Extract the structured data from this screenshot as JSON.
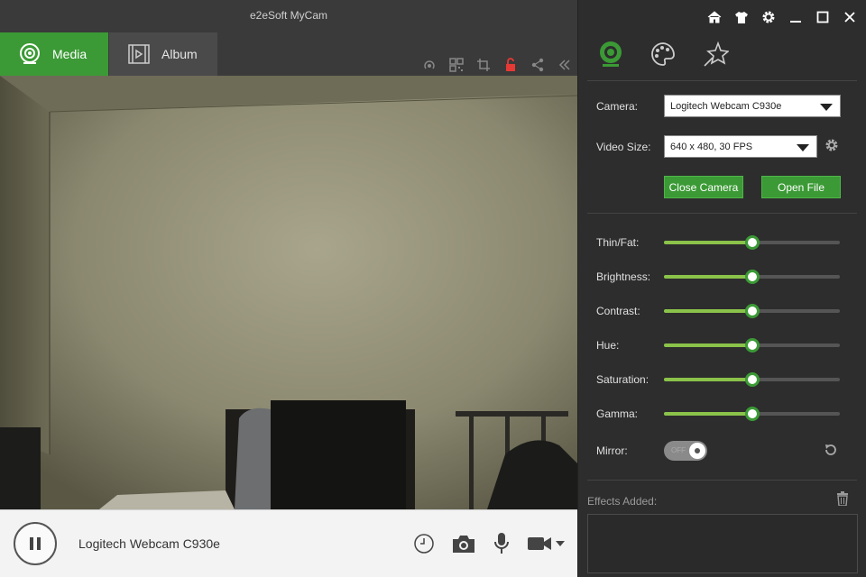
{
  "window": {
    "title": "e2eSoft MyCam"
  },
  "tabs": [
    {
      "label": "Media",
      "icon": "webcam-icon",
      "active": true
    },
    {
      "label": "Album",
      "icon": "film-icon",
      "active": false
    }
  ],
  "toolbar_icons": [
    "broadcast-icon",
    "qr-code-icon",
    "crop-icon",
    "unlock-icon",
    "share-icon",
    "collapse-icon"
  ],
  "window_controls": [
    "home-icon",
    "shirt-icon",
    "gear-icon",
    "minimize-icon",
    "maximize-icon",
    "close-icon"
  ],
  "panel_tabs": [
    "webcam-icon",
    "palette-icon",
    "stars-icon"
  ],
  "camera": {
    "label": "Camera:",
    "value": "Logitech Webcam C930e",
    "video_size_label": "Video Size:",
    "video_size_value": "640 x 480, 30 FPS",
    "close_button": "Close Camera",
    "open_file_button": "Open File"
  },
  "adjustments": [
    {
      "label": "Thin/Fat:",
      "level": 0.5
    },
    {
      "label": "Brightness:",
      "level": 0.5
    },
    {
      "label": "Contrast:",
      "level": 0.5
    },
    {
      "label": "Hue:",
      "level": 0.5
    },
    {
      "label": "Saturation:",
      "level": 0.5
    },
    {
      "label": "Gamma:",
      "level": 0.5
    }
  ],
  "mirror": {
    "label": "Mirror:",
    "state": "on"
  },
  "effects": {
    "label": "Effects Added:"
  },
  "statusbar": {
    "device_text": "Logitech Webcam C930e",
    "icons": [
      "timer-icon",
      "camera-icon",
      "microphone-icon",
      "video-camera-icon",
      "dropdown-arrow-icon"
    ]
  },
  "colors": {
    "accent": "#3b9a35",
    "slider_fill": "#8bc34a",
    "unlock": "#e53935"
  }
}
